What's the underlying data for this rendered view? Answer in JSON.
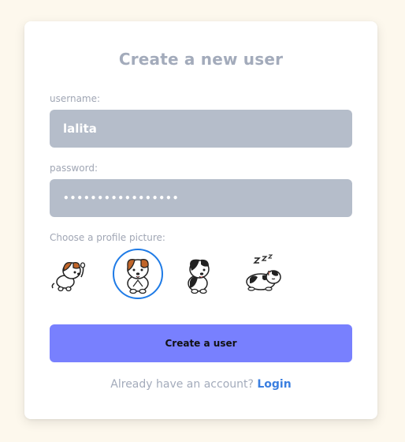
{
  "form": {
    "title": "Create a new user",
    "username_label": "username:",
    "username_value": "lalita",
    "password_label": "password:",
    "password_value": "•••••••••••••••••",
    "picture_label": "Choose a profile picture:",
    "submit_label": "Create a user"
  },
  "avatars": [
    {
      "icon": "dog-waving-icon",
      "selected": false
    },
    {
      "icon": "dog-sitting-icon",
      "selected": true
    },
    {
      "icon": "black-white-dog-icon",
      "selected": false
    },
    {
      "icon": "sleeping-dog-icon",
      "selected": false
    }
  ],
  "footer": {
    "text": "Already have an account?",
    "link": "Login"
  },
  "colors": {
    "background": "#fdf8ed",
    "input_fill": "#b5bdca",
    "button": "#7880fe",
    "selected_ring": "#1f7be6",
    "link": "#3b7fe0"
  }
}
